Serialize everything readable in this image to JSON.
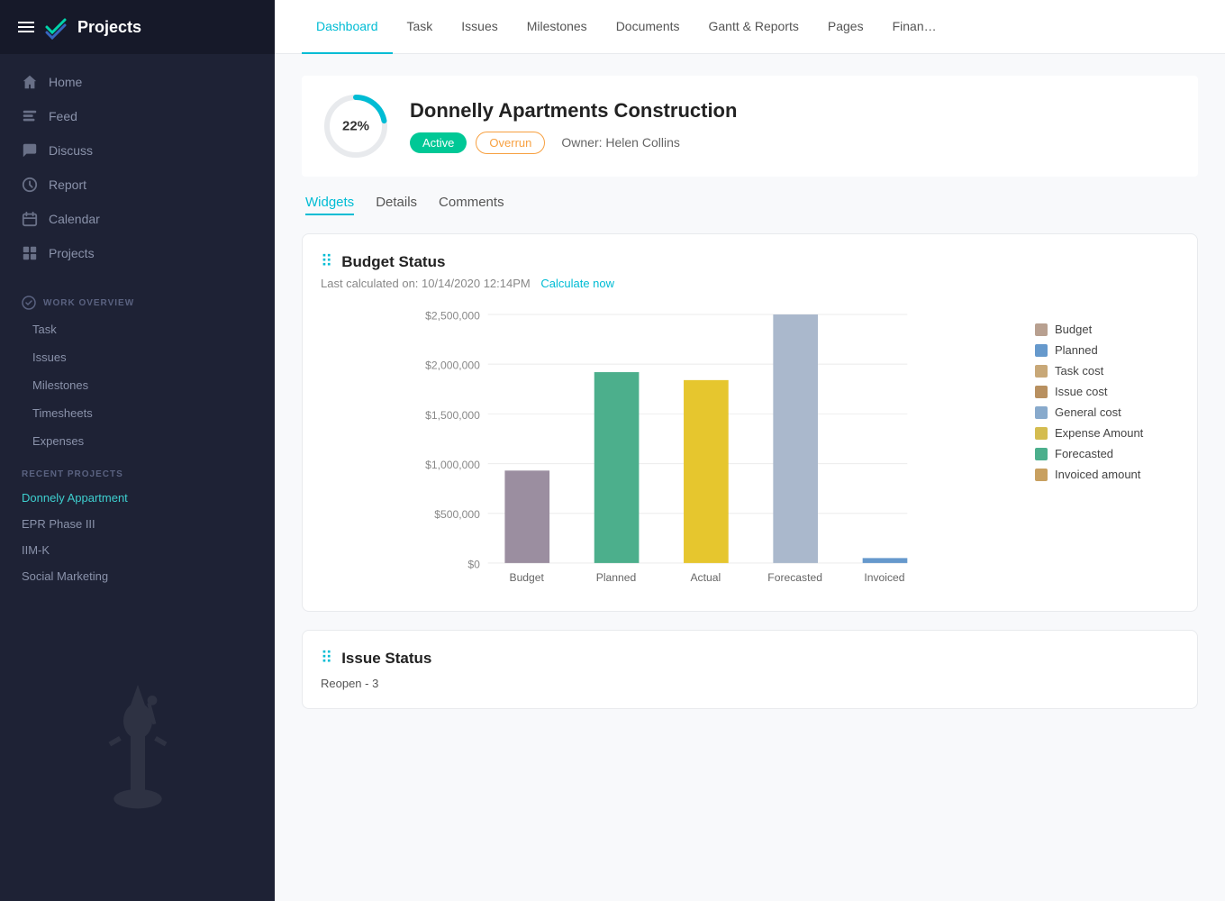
{
  "sidebar": {
    "brand": "Projects",
    "nav_items": [
      {
        "id": "home",
        "label": "Home",
        "icon": "home"
      },
      {
        "id": "feed",
        "label": "Feed",
        "icon": "feed"
      },
      {
        "id": "discuss",
        "label": "Discuss",
        "icon": "discuss"
      },
      {
        "id": "report",
        "label": "Report",
        "icon": "report"
      },
      {
        "id": "calendar",
        "label": "Calendar",
        "icon": "calendar"
      },
      {
        "id": "projects",
        "label": "Projects",
        "icon": "projects"
      }
    ],
    "work_overview_label": "WORK OVERVIEW",
    "work_overview_items": [
      {
        "label": "Task"
      },
      {
        "label": "Issues"
      },
      {
        "label": "Milestones"
      },
      {
        "label": "Timesheets"
      },
      {
        "label": "Expenses"
      }
    ],
    "recent_projects_label": "RECENT PROJECTS",
    "recent_projects": [
      {
        "label": "Donnely Appartment",
        "active": true
      },
      {
        "label": "EPR Phase III"
      },
      {
        "label": "IIM-K"
      },
      {
        "label": "Social Marketing"
      }
    ]
  },
  "top_nav": {
    "items": [
      {
        "label": "Dashboard",
        "active": true
      },
      {
        "label": "Task"
      },
      {
        "label": "Issues"
      },
      {
        "label": "Milestones"
      },
      {
        "label": "Documents"
      },
      {
        "label": "Gantt & Reports"
      },
      {
        "label": "Pages"
      },
      {
        "label": "Finan…"
      }
    ]
  },
  "project": {
    "progress": 22,
    "progress_label": "22%",
    "title": "Donnelly Apartments Construction",
    "badge_active": "Active",
    "badge_overrun": "Overrun",
    "owner_label": "Owner: Helen Collins"
  },
  "sub_tabs": [
    {
      "label": "Widgets",
      "active": true
    },
    {
      "label": "Details"
    },
    {
      "label": "Comments"
    }
  ],
  "budget_widget": {
    "title": "Budget Status",
    "grid_icon": "⠿",
    "subtitle_prefix": "Last calculated on: 10/14/2020 12:14PM",
    "calculate_label": "Calculate now",
    "chart": {
      "y_labels": [
        "$2,500,000",
        "$2,000,000",
        "$1,500,000",
        "$1,000,000",
        "$500,000",
        "$0"
      ],
      "bars": [
        {
          "label": "Budget",
          "value": 1000000,
          "color": "#9b8ea0"
        },
        {
          "label": "Planned",
          "value": 2050000,
          "color": "#4caf8c"
        },
        {
          "label": "Actual",
          "value": 1950000,
          "color": "#e6c62e"
        },
        {
          "label": "Forecasted",
          "value": 2700000,
          "color": "#aab8cc"
        },
        {
          "label": "Invoiced",
          "value": 60000,
          "color": "#6699cc"
        }
      ],
      "max_value": 2700000,
      "legend": [
        {
          "label": "Budget",
          "color": "#b8a090"
        },
        {
          "label": "Planned",
          "color": "#6699cc"
        },
        {
          "label": "Task cost",
          "color": "#c8a878"
        },
        {
          "label": "Issue cost",
          "color": "#b89060"
        },
        {
          "label": "General cost",
          "color": "#88aacc"
        },
        {
          "label": "Expense Amount",
          "color": "#d4bc50"
        },
        {
          "label": "Forecasted",
          "color": "#4caf8c"
        },
        {
          "label": "Invoiced amount",
          "color": "#c8a060"
        }
      ]
    }
  },
  "issue_widget": {
    "title": "Issue Status",
    "grid_icon": "⠿",
    "reopen_label": "Reopen - 3"
  }
}
